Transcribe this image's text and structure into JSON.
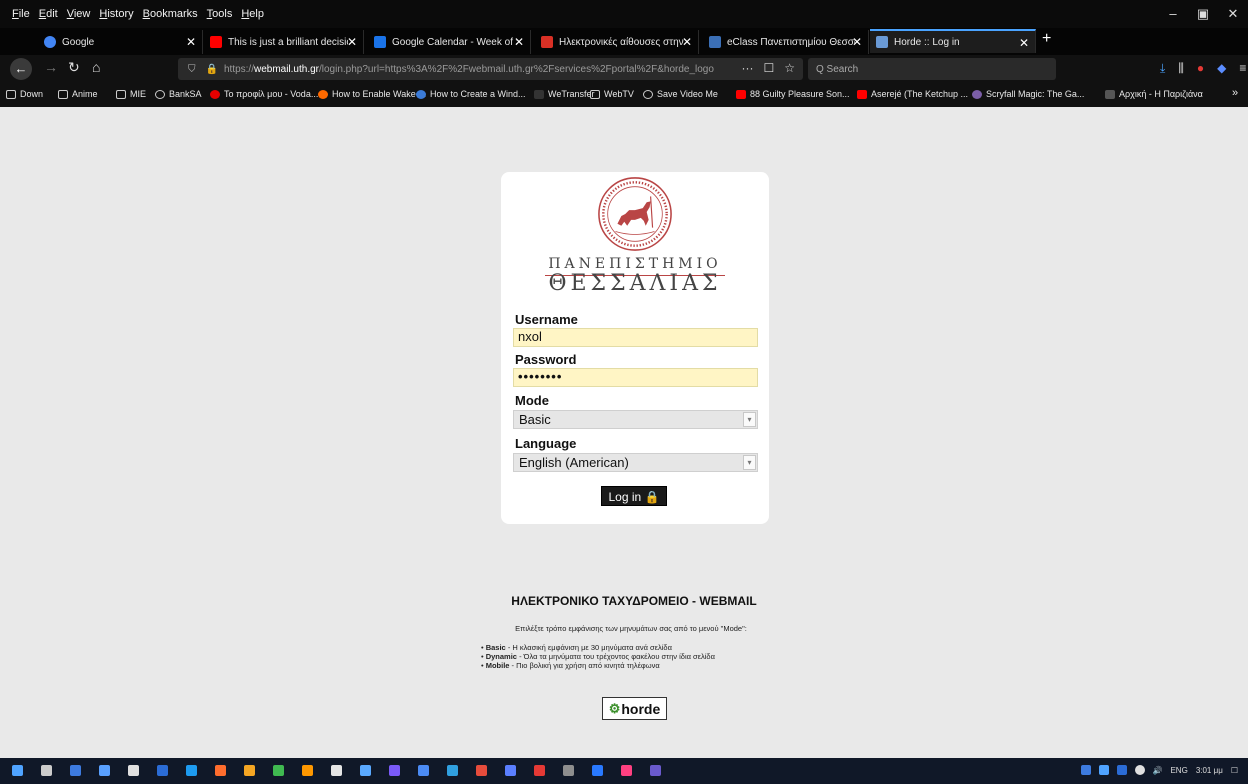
{
  "menubar": {
    "items": [
      "File",
      "Edit",
      "View",
      "History",
      "Bookmarks",
      "Tools",
      "Help"
    ]
  },
  "window_controls": {
    "minimize": "–",
    "maximize": "▣",
    "close": "✕"
  },
  "tabs": [
    {
      "title": "Google",
      "favicon_color": "#4285f4"
    },
    {
      "title": "This is just a brilliant decision!!",
      "favicon_color": "#ff0000"
    },
    {
      "title": "Google Calendar - Week of Sep",
      "favicon_color": "#1a73e8"
    },
    {
      "title": "Ηλεκτρονικές αίθουσες στην",
      "favicon_color": "#d93025"
    },
    {
      "title": "eClass Πανεπιστημίου Θεσσα",
      "favicon_color": "#3b6fb6"
    },
    {
      "title": "Horde :: Log in",
      "favicon_color": "#6a9ad6"
    }
  ],
  "navbar": {
    "url_prefix": "https://",
    "url_domain": "webmail.uth.gr",
    "url_rest": "/login.php?url=https%3A%2F%2Fwebmail.uth.gr%2Fservices%2Fportal%2F&horde_logo",
    "search_placeholder": "Q Search",
    "page_actions": "···"
  },
  "bookmarks": [
    {
      "label": "Down",
      "type": "folder"
    },
    {
      "label": "Anime",
      "type": "folder"
    },
    {
      "label": "MIE",
      "type": "folder"
    },
    {
      "label": "BankSA",
      "type": "globe"
    },
    {
      "label": "Το προφίλ μου - Voda...",
      "color": "#e60000"
    },
    {
      "label": "How to Enable Wake-...",
      "color": "#ff6a00"
    },
    {
      "label": "How to Create a Wind...",
      "color": "#3b7bd8"
    },
    {
      "label": "WeTransfer",
      "color": "#222222"
    },
    {
      "label": "WebTV",
      "type": "folder"
    },
    {
      "label": "Save Video Me",
      "type": "globe"
    },
    {
      "label": "88 Guilty Pleasure Son...",
      "color": "#ff0000"
    },
    {
      "label": "Aserejé (The Ketchup ...",
      "color": "#ff0000"
    },
    {
      "label": "Scryfall Magic: The Ga...",
      "color": "#7b5ea7"
    },
    {
      "label": "Αρχική - Η Παριζιάνα",
      "color": "#555555"
    }
  ],
  "login": {
    "university_line1": "ΠΑΝΕΠΙΣΤΗΜΙΟ",
    "university_line2": "ΘΕΣΣΑΛΙΑΣ",
    "username_label": "Username",
    "username_value": "nxol",
    "password_label": "Password",
    "password_value": "••••••••",
    "mode_label": "Mode",
    "mode_value": "Basic",
    "language_label": "Language",
    "language_value": "English (American)",
    "login_button": "Log in"
  },
  "info": {
    "title": "ΗΛΕΚΤΡΟΝΙΚΟ ΤΑΧΥΔΡΟΜΕΙΟ - WEBMAIL",
    "subtitle": "Επιλέξτε τρόπο εμφάνισης των μηνυμάτων σας από το μενού \"Mode\":",
    "items": [
      {
        "term": "Basic",
        "desc": " - Η κλασική εμφάνιση με 30 μηνύματα ανά σελίδα"
      },
      {
        "term": "Dynamic",
        "desc": " - Όλα τα μηνύματα του τρέχοντος φακέλου στην ίδια σελίδα"
      },
      {
        "term": "Mobile",
        "desc": " - Πιο βολική για χρήση από κινητά τηλέφωνα"
      }
    ],
    "footer_logo": "horde"
  },
  "taskbar": {
    "lang": "ENG",
    "time": "3:01 μμ",
    "icon_colors": [
      "#4fa3ff",
      "#cccccc",
      "#3d7be0",
      "#59a0ff",
      "#e0e0e0",
      "#2b6cd6",
      "#1d9bf0",
      "#ff6d2e",
      "#f5a623",
      "#3fb950",
      "#ff9800",
      "#e5e5e5",
      "#5aa9ff",
      "#7a5af8",
      "#4b8bf4",
      "#30a0e0",
      "#e74c3c",
      "#5b7fff",
      "#e53935",
      "#8e8e8e",
      "#2979ff",
      "#ff4081",
      "#6a5acd"
    ]
  }
}
